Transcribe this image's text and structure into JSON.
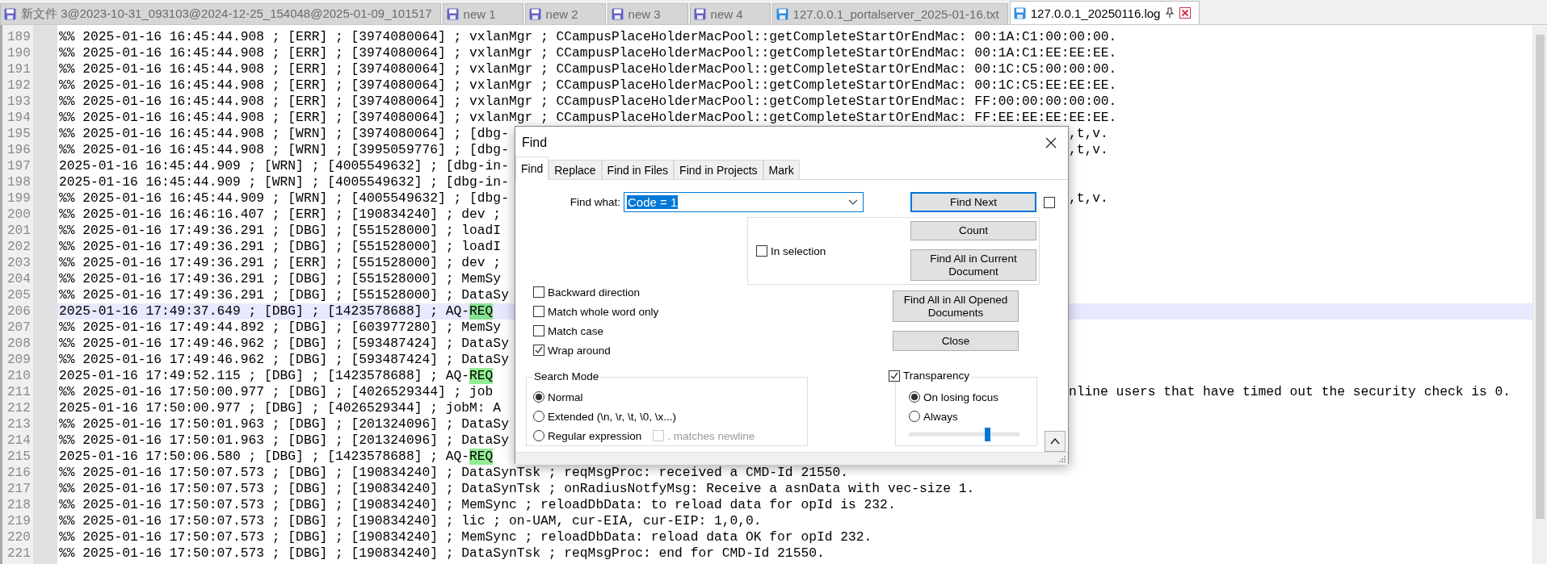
{
  "tabs": [
    {
      "label": "新文件 3@2023-10-31_093103@2024-12-25_154048@2025-01-09_101517",
      "selected": false,
      "color": "#6a62c4"
    },
    {
      "label": "new 1",
      "selected": false,
      "color": "#6a62c4"
    },
    {
      "label": "new 2",
      "selected": false,
      "color": "#6a62c4"
    },
    {
      "label": "new 3",
      "selected": false,
      "color": "#6a62c4"
    },
    {
      "label": "new 4",
      "selected": false,
      "color": "#6a62c4"
    },
    {
      "label": "127.0.0.1_portalserver_2025-01-16.txt",
      "selected": false,
      "color": "#2f8fe0"
    },
    {
      "label": "127.0.0.1_20250116.log",
      "selected": true,
      "color": "#2f8fe0"
    }
  ],
  "editor": {
    "lines": [
      {
        "number": "189",
        "text": "%% 2025-01-16 16:45:44.908 ; [ERR] ; [3974080064] ; vxlanMgr ; CCampusPlaceHolderMacPool::getCompleteStartOrEndMac: 00:1A:C1:00:00:00.",
        "current": false
      },
      {
        "number": "190",
        "text": "%% 2025-01-16 16:45:44.908 ; [ERR] ; [3974080064] ; vxlanMgr ; CCampusPlaceHolderMacPool::getCompleteStartOrEndMac: 00:1A:C1:EE:EE:EE.",
        "current": false
      },
      {
        "number": "191",
        "text": "%% 2025-01-16 16:45:44.908 ; [ERR] ; [3974080064] ; vxlanMgr ; CCampusPlaceHolderMacPool::getCompleteStartOrEndMac: 00:1C:C5:00:00:00.",
        "current": false
      },
      {
        "number": "192",
        "text": "%% 2025-01-16 16:45:44.908 ; [ERR] ; [3974080064] ; vxlanMgr ; CCampusPlaceHolderMacPool::getCompleteStartOrEndMac: 00:1C:C5:EE:EE:EE.",
        "current": false
      },
      {
        "number": "193",
        "text": "%% 2025-01-16 16:45:44.908 ; [ERR] ; [3974080064] ; vxlanMgr ; CCampusPlaceHolderMacPool::getCompleteStartOrEndMac: FF:00:00:00:00:00.",
        "current": false
      },
      {
        "number": "194",
        "text": "%% 2025-01-16 16:45:44.908 ; [ERR] ; [3974080064] ; vxlanMgr ; CCampusPlaceHolderMacPool::getCompleteStartOrEndMac: FF:EE:EE:EE:EE:EE.",
        "current": false
      },
      {
        "number": "195",
        "text": "%% 2025-01-16 16:45:44.908 ; [WRN] ; [3974080064] ; [dbg-",
        "tail": ",t,v.",
        "current": false
      },
      {
        "number": "196",
        "text": "%% 2025-01-16 16:45:44.908 ; [WRN] ; [3995059776] ; [dbg-",
        "tail": ",t,v.",
        "current": false
      },
      {
        "number": "197",
        "text": "2025-01-16 16:45:44.909 ; [WRN] ; [4005549632] ; [dbg-in-",
        "current": false
      },
      {
        "number": "198",
        "text": "2025-01-16 16:45:44.909 ; [WRN] ; [4005549632] ; [dbg-in-",
        "current": false
      },
      {
        "number": "199",
        "text": "%% 2025-01-16 16:45:44.909 ; [WRN] ; [4005549632] ; [dbg-",
        "tail": ",t,v.",
        "current": false
      },
      {
        "number": "200",
        "text": "%% 2025-01-16 16:46:16.407 ; [ERR] ; [190834240] ; dev ;",
        "current": false
      },
      {
        "number": "201",
        "text": "%% 2025-01-16 17:49:36.291 ; [DBG] ; [551528000] ; loadI",
        "current": false
      },
      {
        "number": "202",
        "text": "%% 2025-01-16 17:49:36.291 ; [DBG] ; [551528000] ; loadI",
        "current": false
      },
      {
        "number": "203",
        "text": "%% 2025-01-16 17:49:36.291 ; [ERR] ; [551528000] ; dev ;",
        "current": false
      },
      {
        "number": "204",
        "text": "%% 2025-01-16 17:49:36.291 ; [DBG] ; [551528000] ; MemSy",
        "current": false
      },
      {
        "number": "205",
        "text": "%% 2025-01-16 17:49:36.291 ; [DBG] ; [551528000] ; DataSy",
        "current": false
      },
      {
        "number": "206",
        "text": "2025-01-16 17:49:37.649 ; [DBG] ; [1423578688] ; AQ-",
        "match": "REQ",
        "current": true
      },
      {
        "number": "207",
        "text": "%% 2025-01-16 17:49:44.892 ; [DBG] ; [603977280] ; MemSy",
        "current": false
      },
      {
        "number": "208",
        "text": "%% 2025-01-16 17:49:46.962 ; [DBG] ; [593487424] ; DataSy",
        "current": false
      },
      {
        "number": "209",
        "text": "%% 2025-01-16 17:49:46.962 ; [DBG] ; [593487424] ; DataSy",
        "current": false
      },
      {
        "number": "210",
        "text": "2025-01-16 17:49:52.115 ; [DBG] ; [1423578688] ; AQ-",
        "match": "REQ",
        "current": false
      },
      {
        "number": "211",
        "text": "%% 2025-01-16 17:50:00.977 ; [DBG] ; [4026529344] ; job",
        "tail": "nline users that have timed out the security check is 0.",
        "current": false
      },
      {
        "number": "212",
        "text": "2025-01-16 17:50:00.977 ; [DBG] ; [4026529344] ; jobM: A",
        "current": false
      },
      {
        "number": "213",
        "text": "%% 2025-01-16 17:50:01.963 ; [DBG] ; [201324096] ; DataSy",
        "current": false
      },
      {
        "number": "214",
        "text": "%% 2025-01-16 17:50:01.963 ; [DBG] ; [201324096] ; DataSy",
        "current": false
      },
      {
        "number": "215",
        "text": "2025-01-16 17:50:06.580 ; [DBG] ; [1423578688] ; AQ-",
        "match": "REQ",
        "current": false
      },
      {
        "number": "216",
        "text": "%% 2025-01-16 17:50:07.573 ; [DBG] ; [190834240] ; DataSynTsk ; reqMsgProc: received a CMD-Id 21550.",
        "current": false
      },
      {
        "number": "217",
        "text": "%% 2025-01-16 17:50:07.573 ; [DBG] ; [190834240] ; DataSynTsk ; onRadiusNotfyMsg: Receive a asnData with vec-size 1.",
        "current": false
      },
      {
        "number": "218",
        "text": "%% 2025-01-16 17:50:07.573 ; [DBG] ; [190834240] ; MemSync ; reloadDbData: to reload data for opId is 232.",
        "current": false
      },
      {
        "number": "219",
        "text": "%% 2025-01-16 17:50:07.573 ; [DBG] ; [190834240] ; lic ; on-UAM, cur-EIA, cur-EIP: 1,0,0.",
        "current": false
      },
      {
        "number": "220",
        "text": "%% 2025-01-16 17:50:07.573 ; [DBG] ; [190834240] ; MemSync ; reloadDbData: reload data OK for opId 232.",
        "current": false
      },
      {
        "number": "221",
        "text": "%% 2025-01-16 17:50:07.573 ; [DBG] ; [190834240] ; DataSynTsk ; reqMsgProc: end for CMD-Id 21550.",
        "current": false
      }
    ]
  },
  "find_dialog": {
    "title": "Find",
    "tabs": [
      {
        "label": "Find",
        "selected": true
      },
      {
        "label": "Replace",
        "selected": false
      },
      {
        "label": "Find in Files",
        "selected": false
      },
      {
        "label": "Find in Projects",
        "selected": false
      },
      {
        "label": "Mark",
        "selected": false
      }
    ],
    "find_what": {
      "label": "Find what:",
      "value": "Code = 1"
    },
    "find_next": "Find Next",
    "side_checkbox": {
      "checked": false
    },
    "in_selection": {
      "label": "In selection",
      "checked": false
    },
    "count": "Count",
    "find_all_current": "Find All in Current Document",
    "find_all_opened": "Find All in All Opened Documents",
    "close": "Close",
    "options": [
      {
        "label": "Backward direction",
        "checked": false
      },
      {
        "label": "Match whole word only",
        "checked": false
      },
      {
        "label": "Match case",
        "checked": false
      },
      {
        "label": "Wrap around",
        "checked": true
      }
    ],
    "search_mode": {
      "title": "Search Mode",
      "modes": [
        {
          "label": "Normal",
          "selected": true
        },
        {
          "label": "Extended (\\n, \\r, \\t, \\0, \\x...)",
          "selected": false
        },
        {
          "label": "Regular expression",
          "selected": false
        }
      ],
      "matches_newline": {
        "label": ". matches newline",
        "checked": false,
        "disabled": true
      }
    },
    "transparency": {
      "label": "Transparency",
      "checked": true,
      "modes": [
        {
          "label": "On losing focus",
          "selected": true
        },
        {
          "label": "Always",
          "selected": false
        }
      ],
      "level": 0.71
    }
  }
}
